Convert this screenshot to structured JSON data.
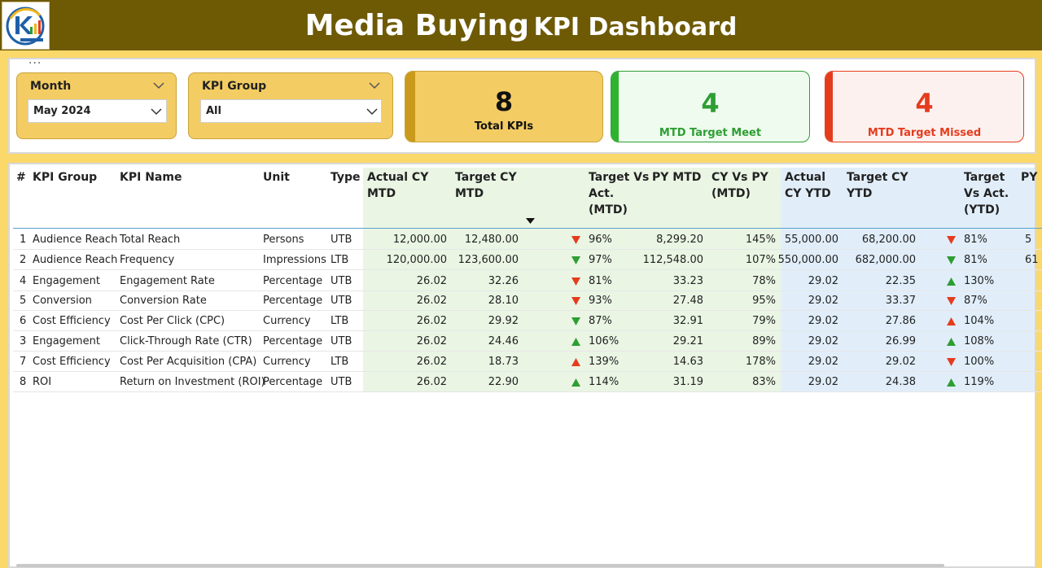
{
  "header": {
    "title_main": "Media Buying",
    "title_sub": "KPI Dashboard",
    "logo_icon": "kpi-logo-icon"
  },
  "more_options": "...",
  "slicers": {
    "month": {
      "label": "Month",
      "value": "May 2024"
    },
    "kpi_group": {
      "label": "KPI Group",
      "value": "All"
    }
  },
  "cards": {
    "total": {
      "value": "8",
      "label": "Total KPIs"
    },
    "meet": {
      "value": "4",
      "label": "MTD Target Meet"
    },
    "missed": {
      "value": "4",
      "label": "MTD Target Missed"
    }
  },
  "colors": {
    "header_bg": "#6e5a05",
    "page_bg": "#fbd86a",
    "green": "#2e9e33",
    "red": "#e53c1e",
    "mtd_bg": "#eaf5e4",
    "ytd_bg": "#e1eefa"
  },
  "table": {
    "headers": {
      "num": "#",
      "group": "KPI Group",
      "name": "KPI Name",
      "unit": "Unit",
      "type": "Type",
      "actual_mtd": [
        "Actual CY",
        "MTD"
      ],
      "target_mtd": [
        "Target CY",
        "MTD"
      ],
      "tva_mtd": [
        "Target Vs",
        "Act.",
        "(MTD)"
      ],
      "py_mtd": [
        "PY MTD"
      ],
      "cy_vs_py": [
        "CY Vs PY",
        "(MTD)"
      ],
      "actual_ytd": [
        "Actual",
        "CY YTD"
      ],
      "target_ytd": [
        "Target CY",
        "YTD"
      ],
      "tva_ytd": [
        "Target",
        "Vs Act.",
        "(YTD)"
      ],
      "py_ytd_partial": "PY"
    },
    "rows": [
      {
        "num": "1",
        "group": "Audience Reach",
        "name": "Total Reach",
        "unit": "Persons",
        "type": "UTB",
        "actual_mtd": "12,000.00",
        "target_mtd": "12,480.00",
        "mtd_status": "down-red",
        "tva_mtd": "96%",
        "py_mtd": "8,299.20",
        "cy_vs_py": "145%",
        "actual_ytd": "55,000.00",
        "target_ytd": "68,200.00",
        "ytd_status": "down-red",
        "tva_ytd": "81%",
        "py_ytd_partial": "5"
      },
      {
        "num": "2",
        "group": "Audience Reach",
        "name": "Frequency",
        "unit": "Impressions",
        "type": "LTB",
        "actual_mtd": "120,000.00",
        "target_mtd": "123,600.00",
        "mtd_status": "down-green",
        "tva_mtd": "97%",
        "py_mtd": "112,548.00",
        "cy_vs_py": "107%",
        "actual_ytd": "550,000.00",
        "target_ytd": "682,000.00",
        "ytd_status": "down-green",
        "tva_ytd": "81%",
        "py_ytd_partial": "61"
      },
      {
        "num": "4",
        "group": "Engagement",
        "name": "Engagement Rate",
        "unit": "Percentage",
        "type": "UTB",
        "actual_mtd": "26.02",
        "target_mtd": "32.26",
        "mtd_status": "down-red",
        "tva_mtd": "81%",
        "py_mtd": "33.23",
        "cy_vs_py": "78%",
        "actual_ytd": "29.02",
        "target_ytd": "22.35",
        "ytd_status": "up-green",
        "tva_ytd": "130%",
        "py_ytd_partial": ""
      },
      {
        "num": "5",
        "group": "Conversion",
        "name": "Conversion Rate",
        "unit": "Percentage",
        "type": "UTB",
        "actual_mtd": "26.02",
        "target_mtd": "28.10",
        "mtd_status": "down-red",
        "tva_mtd": "93%",
        "py_mtd": "27.48",
        "cy_vs_py": "95%",
        "actual_ytd": "29.02",
        "target_ytd": "33.37",
        "ytd_status": "down-red",
        "tva_ytd": "87%",
        "py_ytd_partial": ""
      },
      {
        "num": "6",
        "group": "Cost Efficiency",
        "name": "Cost Per Click (CPC)",
        "unit": "Currency",
        "type": "LTB",
        "actual_mtd": "26.02",
        "target_mtd": "29.92",
        "mtd_status": "down-green",
        "tva_mtd": "87%",
        "py_mtd": "32.91",
        "cy_vs_py": "79%",
        "actual_ytd": "29.02",
        "target_ytd": "27.86",
        "ytd_status": "up-red",
        "tva_ytd": "104%",
        "py_ytd_partial": ""
      },
      {
        "num": "3",
        "group": "Engagement",
        "name": "Click-Through Rate (CTR)",
        "unit": "Percentage",
        "type": "UTB",
        "actual_mtd": "26.02",
        "target_mtd": "24.46",
        "mtd_status": "up-green",
        "tva_mtd": "106%",
        "py_mtd": "29.21",
        "cy_vs_py": "89%",
        "actual_ytd": "29.02",
        "target_ytd": "26.99",
        "ytd_status": "up-green",
        "tva_ytd": "108%",
        "py_ytd_partial": ""
      },
      {
        "num": "7",
        "group": "Cost Efficiency",
        "name": "Cost Per Acquisition (CPA)",
        "unit": "Currency",
        "type": "LTB",
        "actual_mtd": "26.02",
        "target_mtd": "18.73",
        "mtd_status": "up-red",
        "tva_mtd": "139%",
        "py_mtd": "14.63",
        "cy_vs_py": "178%",
        "actual_ytd": "29.02",
        "target_ytd": "29.02",
        "ytd_status": "down-red",
        "tva_ytd": "100%",
        "py_ytd_partial": ""
      },
      {
        "num": "8",
        "group": "ROI",
        "name": "Return on Investment (ROI)",
        "unit": "Percentage",
        "type": "UTB",
        "actual_mtd": "26.02",
        "target_mtd": "22.90",
        "mtd_status": "up-green",
        "tva_mtd": "114%",
        "py_mtd": "31.19",
        "cy_vs_py": "83%",
        "actual_ytd": "29.02",
        "target_ytd": "24.38",
        "ytd_status": "up-green",
        "tva_ytd": "119%",
        "py_ytd_partial": ""
      }
    ]
  }
}
